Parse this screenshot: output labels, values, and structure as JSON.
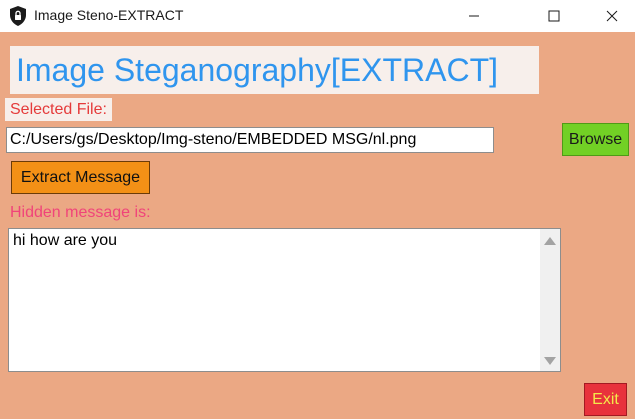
{
  "window": {
    "title": "Image Steno-EXTRACT",
    "icon": "shield-lock-icon",
    "controls": [
      "minimize-icon",
      "maximize-icon",
      "close-icon"
    ]
  },
  "main": {
    "heading": "Image Steganography[EXTRACT]",
    "selected_file_label": "Selected File:",
    "file_path": "C:/Users/gs/Desktop/Img-steno/EMBEDDED MSG/nl.png",
    "browse_label": "Browse",
    "extract_label": "Extract Message",
    "hidden_label": "Hidden message is:",
    "hidden_message": "hi how are you",
    "exit_label": "Exit"
  },
  "colors": {
    "background": "#eba884",
    "heading_text": "#2f95ee",
    "label_text": "#e53a3a",
    "hidden_label_text": "#f0447a",
    "browse_button": "#72d025",
    "extract_button": "#f39016",
    "exit_button": "#e8323c",
    "exit_text": "#f4e84a"
  }
}
